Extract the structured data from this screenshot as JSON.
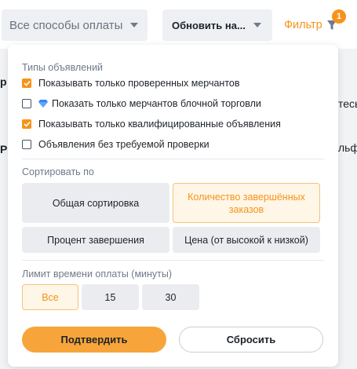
{
  "topbar": {
    "payment_select": "Все способы оплаты",
    "refresh_select": "Обновить на...",
    "filter_label": "Фильтр",
    "filter_badge": "1"
  },
  "background": {
    "left_frag_1": "р",
    "right_frag_1": "тесь",
    "left_frag_2": "Р",
    "right_frag_2": "льфа"
  },
  "panel": {
    "ad_types": {
      "title": "Типы объявлений",
      "options": [
        {
          "label": "Показывать только проверенных мерчантов",
          "checked": true
        },
        {
          "label": "Показать только мерчантов блочной торговли",
          "checked": false,
          "icon": "diamond-icon"
        },
        {
          "label": "Показывать только квалифицированные объявления",
          "checked": true
        },
        {
          "label": "Объявления без требуемой проверки",
          "checked": false
        }
      ]
    },
    "sort": {
      "title": "Сортировать по",
      "options": [
        {
          "label": "Общая сортировка",
          "active": false
        },
        {
          "label": "Количество завершённых заказов",
          "active": true
        },
        {
          "label": "Процент завершения",
          "active": false
        },
        {
          "label": "Цена (от высокой к низкой)",
          "active": false
        }
      ]
    },
    "time_limit": {
      "title": "Лимит времени оплаты (минуты)",
      "options": [
        {
          "label": "Все",
          "active": true
        },
        {
          "label": "15",
          "active": false
        },
        {
          "label": "30",
          "active": false
        }
      ]
    },
    "confirm_label": "Подтвердить",
    "reset_label": "Сбросить"
  },
  "colors": {
    "accent": "#f7931a",
    "confirm_bg": "#f7a53a",
    "chip_bg": "#eaecef"
  }
}
